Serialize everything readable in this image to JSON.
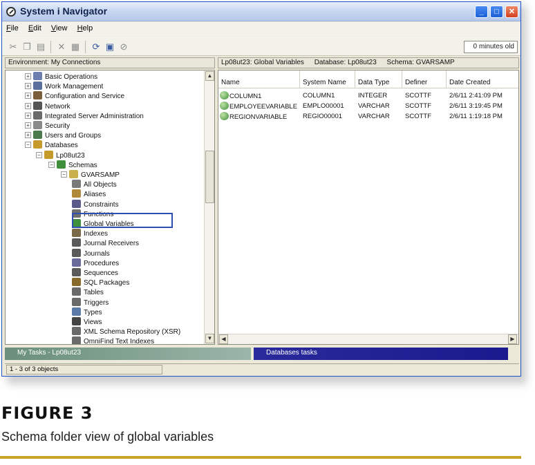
{
  "window": {
    "title": "System i Navigator"
  },
  "menubar": [
    "File",
    "Edit",
    "View",
    "Help"
  ],
  "toolbar": {
    "timer": "0 minutes old"
  },
  "left_header": "Environment: My Connections",
  "right_header": {
    "system": "Lp08ut23: Global Variables",
    "database": "Database: Lp08ut23",
    "schema": "Schema: GVARSAMP"
  },
  "tree": {
    "items": [
      {
        "label": "Basic Operations",
        "icon": "basic-operations-icon",
        "color": "#6d7fb0"
      },
      {
        "label": "Work Management",
        "icon": "work-management-icon",
        "color": "#5b6f9c"
      },
      {
        "label": "Configuration and Service",
        "icon": "configuration-icon",
        "color": "#7a5f3a"
      },
      {
        "label": "Network",
        "icon": "network-icon",
        "color": "#555555"
      },
      {
        "label": "Integrated Server Administration",
        "icon": "server-icon",
        "color": "#6b6b6b"
      },
      {
        "label": "Security",
        "icon": "security-icon",
        "color": "#8a8a8a"
      },
      {
        "label": "Users and Groups",
        "icon": "users-icon",
        "color": "#4d7a4d"
      },
      {
        "label": "Databases",
        "icon": "databases-icon",
        "color": "#c79a2e"
      },
      {
        "label": "Lp08ut23",
        "icon": "database-icon",
        "color": "#c79a2e"
      },
      {
        "label": "Schemas",
        "icon": "schemas-icon",
        "color": "#3f8f3c"
      },
      {
        "label": "GVARSAMP",
        "icon": "schema-icon",
        "color": "#c9b04a"
      },
      {
        "label": "All Objects",
        "icon": "all-objects-icon",
        "color": "#7a7a7a"
      },
      {
        "label": "Aliases",
        "icon": "aliases-icon",
        "color": "#b08a3a"
      },
      {
        "label": "Constraints",
        "icon": "constraints-icon",
        "color": "#5a5a8a"
      },
      {
        "label": "Functions",
        "icon": "functions-icon",
        "color": "#6f6f6f"
      },
      {
        "label": "Global Variables",
        "icon": "global-variables-icon",
        "color": "#3f8f3c"
      },
      {
        "label": "Indexes",
        "icon": "indexes-icon",
        "color": "#7a6a4a"
      },
      {
        "label": "Journal Receivers",
        "icon": "journal-receivers-icon",
        "color": "#5a5a5a"
      },
      {
        "label": "Journals",
        "icon": "journals-icon",
        "color": "#5a5a5a"
      },
      {
        "label": "Procedures",
        "icon": "procedures-icon",
        "color": "#6a6a9a"
      },
      {
        "label": "Sequences",
        "icon": "sequences-icon",
        "color": "#5a5a5a"
      },
      {
        "label": "SQL Packages",
        "icon": "sql-packages-icon",
        "color": "#8a6a2a"
      },
      {
        "label": "Tables",
        "icon": "tables-icon",
        "color": "#6a6a6a"
      },
      {
        "label": "Triggers",
        "icon": "triggers-icon",
        "color": "#6a6a6a"
      },
      {
        "label": "Types",
        "icon": "types-icon",
        "color": "#5a7aaa"
      },
      {
        "label": "Views",
        "icon": "views-icon",
        "color": "#444444"
      },
      {
        "label": "XML Schema Repository (XSR)",
        "icon": "xsr-icon",
        "color": "#6a6a6a"
      },
      {
        "label": "OmniFind Text Indexes",
        "icon": "omnifind-icon",
        "color": "#6a6a6a"
      }
    ]
  },
  "table": {
    "columns": [
      "Name",
      "System Name",
      "Data Type",
      "Definer",
      "Date Created"
    ],
    "rows": [
      [
        "COLUMN1",
        "COLUMN1",
        "INTEGER",
        "SCOTTF",
        "2/6/11 2:41:09 PM"
      ],
      [
        "EMPLOYEEVARIABLE",
        "EMPLO00001",
        "VARCHAR",
        "SCOTTF",
        "2/6/11 3:19:45 PM"
      ],
      [
        "REGIONVARIABLE",
        "REGIO00001",
        "VARCHAR",
        "SCOTTF",
        "2/6/11 1:19:18 PM"
      ]
    ]
  },
  "tasks": {
    "left": "My Tasks - Lp08ut23",
    "right": "Databases tasks"
  },
  "status": "1 - 3 of 3 objects",
  "figure": {
    "label": "FIGURE 3",
    "caption": "Schema folder view of global variables"
  },
  "colors": {
    "highlight": "#2d4fb2",
    "rule": "#c9a227"
  }
}
